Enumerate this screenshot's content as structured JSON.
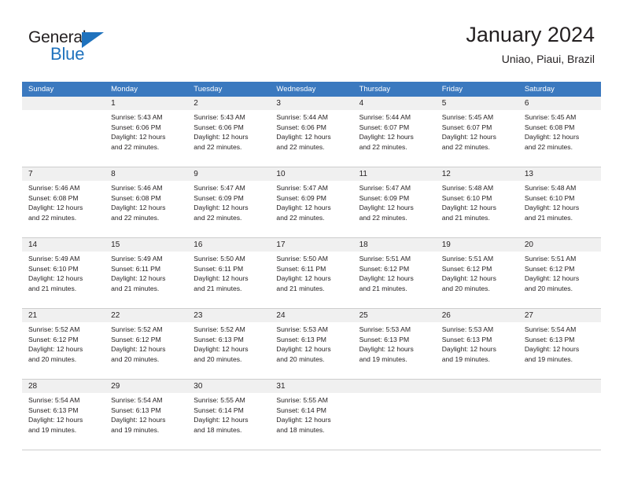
{
  "logo": {
    "text_primary": "General",
    "text_secondary": "Blue",
    "triangle_icon": "blue-triangle-icon",
    "primary_color": "#231f20",
    "accent_color": "#1f72bd"
  },
  "header": {
    "title": "January 2024",
    "subtitle": "Uniao, Piaui, Brazil"
  },
  "theme": {
    "header_bar_color": "#3b79bf",
    "daynum_band_color": "#f0f0f0",
    "grid_line_color": "#cdcdcd",
    "text_color": "#231f20"
  },
  "day_headers": [
    "Sunday",
    "Monday",
    "Tuesday",
    "Wednesday",
    "Thursday",
    "Friday",
    "Saturday"
  ],
  "weeks": [
    [
      {
        "day": "",
        "lines": []
      },
      {
        "day": "1",
        "lines": [
          "Sunrise: 5:43 AM",
          "Sunset: 6:06 PM",
          "Daylight: 12 hours",
          "and 22 minutes."
        ]
      },
      {
        "day": "2",
        "lines": [
          "Sunrise: 5:43 AM",
          "Sunset: 6:06 PM",
          "Daylight: 12 hours",
          "and 22 minutes."
        ]
      },
      {
        "day": "3",
        "lines": [
          "Sunrise: 5:44 AM",
          "Sunset: 6:06 PM",
          "Daylight: 12 hours",
          "and 22 minutes."
        ]
      },
      {
        "day": "4",
        "lines": [
          "Sunrise: 5:44 AM",
          "Sunset: 6:07 PM",
          "Daylight: 12 hours",
          "and 22 minutes."
        ]
      },
      {
        "day": "5",
        "lines": [
          "Sunrise: 5:45 AM",
          "Sunset: 6:07 PM",
          "Daylight: 12 hours",
          "and 22 minutes."
        ]
      },
      {
        "day": "6",
        "lines": [
          "Sunrise: 5:45 AM",
          "Sunset: 6:08 PM",
          "Daylight: 12 hours",
          "and 22 minutes."
        ]
      }
    ],
    [
      {
        "day": "7",
        "lines": [
          "Sunrise: 5:46 AM",
          "Sunset: 6:08 PM",
          "Daylight: 12 hours",
          "and 22 minutes."
        ]
      },
      {
        "day": "8",
        "lines": [
          "Sunrise: 5:46 AM",
          "Sunset: 6:08 PM",
          "Daylight: 12 hours",
          "and 22 minutes."
        ]
      },
      {
        "day": "9",
        "lines": [
          "Sunrise: 5:47 AM",
          "Sunset: 6:09 PM",
          "Daylight: 12 hours",
          "and 22 minutes."
        ]
      },
      {
        "day": "10",
        "lines": [
          "Sunrise: 5:47 AM",
          "Sunset: 6:09 PM",
          "Daylight: 12 hours",
          "and 22 minutes."
        ]
      },
      {
        "day": "11",
        "lines": [
          "Sunrise: 5:47 AM",
          "Sunset: 6:09 PM",
          "Daylight: 12 hours",
          "and 22 minutes."
        ]
      },
      {
        "day": "12",
        "lines": [
          "Sunrise: 5:48 AM",
          "Sunset: 6:10 PM",
          "Daylight: 12 hours",
          "and 21 minutes."
        ]
      },
      {
        "day": "13",
        "lines": [
          "Sunrise: 5:48 AM",
          "Sunset: 6:10 PM",
          "Daylight: 12 hours",
          "and 21 minutes."
        ]
      }
    ],
    [
      {
        "day": "14",
        "lines": [
          "Sunrise: 5:49 AM",
          "Sunset: 6:10 PM",
          "Daylight: 12 hours",
          "and 21 minutes."
        ]
      },
      {
        "day": "15",
        "lines": [
          "Sunrise: 5:49 AM",
          "Sunset: 6:11 PM",
          "Daylight: 12 hours",
          "and 21 minutes."
        ]
      },
      {
        "day": "16",
        "lines": [
          "Sunrise: 5:50 AM",
          "Sunset: 6:11 PM",
          "Daylight: 12 hours",
          "and 21 minutes."
        ]
      },
      {
        "day": "17",
        "lines": [
          "Sunrise: 5:50 AM",
          "Sunset: 6:11 PM",
          "Daylight: 12 hours",
          "and 21 minutes."
        ]
      },
      {
        "day": "18",
        "lines": [
          "Sunrise: 5:51 AM",
          "Sunset: 6:12 PM",
          "Daylight: 12 hours",
          "and 21 minutes."
        ]
      },
      {
        "day": "19",
        "lines": [
          "Sunrise: 5:51 AM",
          "Sunset: 6:12 PM",
          "Daylight: 12 hours",
          "and 20 minutes."
        ]
      },
      {
        "day": "20",
        "lines": [
          "Sunrise: 5:51 AM",
          "Sunset: 6:12 PM",
          "Daylight: 12 hours",
          "and 20 minutes."
        ]
      }
    ],
    [
      {
        "day": "21",
        "lines": [
          "Sunrise: 5:52 AM",
          "Sunset: 6:12 PM",
          "Daylight: 12 hours",
          "and 20 minutes."
        ]
      },
      {
        "day": "22",
        "lines": [
          "Sunrise: 5:52 AM",
          "Sunset: 6:12 PM",
          "Daylight: 12 hours",
          "and 20 minutes."
        ]
      },
      {
        "day": "23",
        "lines": [
          "Sunrise: 5:52 AM",
          "Sunset: 6:13 PM",
          "Daylight: 12 hours",
          "and 20 minutes."
        ]
      },
      {
        "day": "24",
        "lines": [
          "Sunrise: 5:53 AM",
          "Sunset: 6:13 PM",
          "Daylight: 12 hours",
          "and 20 minutes."
        ]
      },
      {
        "day": "25",
        "lines": [
          "Sunrise: 5:53 AM",
          "Sunset: 6:13 PM",
          "Daylight: 12 hours",
          "and 19 minutes."
        ]
      },
      {
        "day": "26",
        "lines": [
          "Sunrise: 5:53 AM",
          "Sunset: 6:13 PM",
          "Daylight: 12 hours",
          "and 19 minutes."
        ]
      },
      {
        "day": "27",
        "lines": [
          "Sunrise: 5:54 AM",
          "Sunset: 6:13 PM",
          "Daylight: 12 hours",
          "and 19 minutes."
        ]
      }
    ],
    [
      {
        "day": "28",
        "lines": [
          "Sunrise: 5:54 AM",
          "Sunset: 6:13 PM",
          "Daylight: 12 hours",
          "and 19 minutes."
        ]
      },
      {
        "day": "29",
        "lines": [
          "Sunrise: 5:54 AM",
          "Sunset: 6:13 PM",
          "Daylight: 12 hours",
          "and 19 minutes."
        ]
      },
      {
        "day": "30",
        "lines": [
          "Sunrise: 5:55 AM",
          "Sunset: 6:14 PM",
          "Daylight: 12 hours",
          "and 18 minutes."
        ]
      },
      {
        "day": "31",
        "lines": [
          "Sunrise: 5:55 AM",
          "Sunset: 6:14 PM",
          "Daylight: 12 hours",
          "and 18 minutes."
        ]
      },
      {
        "day": "",
        "lines": []
      },
      {
        "day": "",
        "lines": []
      },
      {
        "day": "",
        "lines": []
      }
    ]
  ]
}
